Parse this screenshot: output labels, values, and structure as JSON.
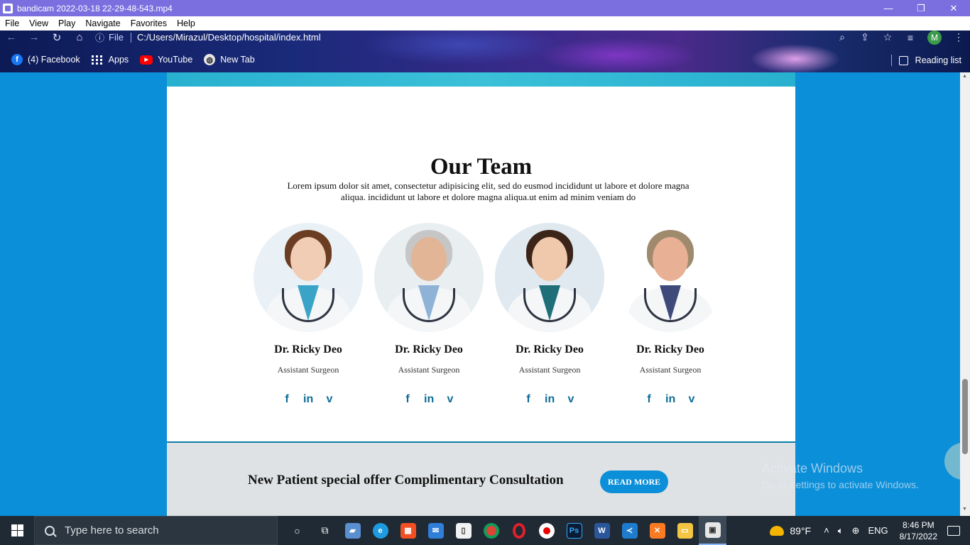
{
  "player": {
    "title": "bandicam 2022-03-18 22-29-48-543.mp4",
    "menu": [
      "File",
      "View",
      "Play",
      "Navigate",
      "Favorites",
      "Help"
    ],
    "controls": {
      "minimize": "—",
      "restore": "❐",
      "close": "✕"
    }
  },
  "browser": {
    "file_label": "File",
    "url": "C:/Users/Mirazul/Desktop/hospital/index.html",
    "avatar_letter": "M",
    "bookmarks": [
      {
        "label": "(4) Facebook",
        "icon": "facebook-icon"
      },
      {
        "label": "Apps",
        "icon": "apps-icon"
      },
      {
        "label": "YouTube",
        "icon": "youtube-icon"
      },
      {
        "label": "New Tab",
        "icon": "globe-icon"
      }
    ],
    "reading_list": "Reading list"
  },
  "page": {
    "team_title": "Our Team",
    "team_desc_line1": "Lorem ipsum dolor sit amet, consectetur adipisicing elit, sed do eusmod incididunt ut labore et dolore magna",
    "team_desc_line2": "aliqua. incididunt ut labore et dolore magna aliqua.ut enim ad minim veniam do",
    "members": [
      {
        "name": "Dr. Ricky Deo",
        "role": "Assistant Surgeon"
      },
      {
        "name": "Dr. Ricky Deo",
        "role": "Assistant Surgeon"
      },
      {
        "name": "Dr. Ricky Deo",
        "role": "Assistant Surgeon"
      },
      {
        "name": "Dr. Ricky Deo",
        "role": "Assistant Surgeon"
      }
    ],
    "social_glyphs": {
      "facebook": "f",
      "linkedin": "in",
      "vimeo": "v"
    },
    "offer_text": "New Patient special offer Complimentary Consultation",
    "offer_button": "READ MORE",
    "colors": {
      "page_bg": "#0b8fd9",
      "accent": "#0e6c98",
      "offer_bg": "#dfe2e4"
    }
  },
  "watermark": {
    "line1": "Activate Windows",
    "line2": "Go to Settings to activate Windows."
  },
  "taskbar": {
    "search_placeholder": "Type here to search",
    "temperature": "89°F",
    "language": "ENG",
    "time": "8:46 PM",
    "date": "8/17/2022"
  }
}
